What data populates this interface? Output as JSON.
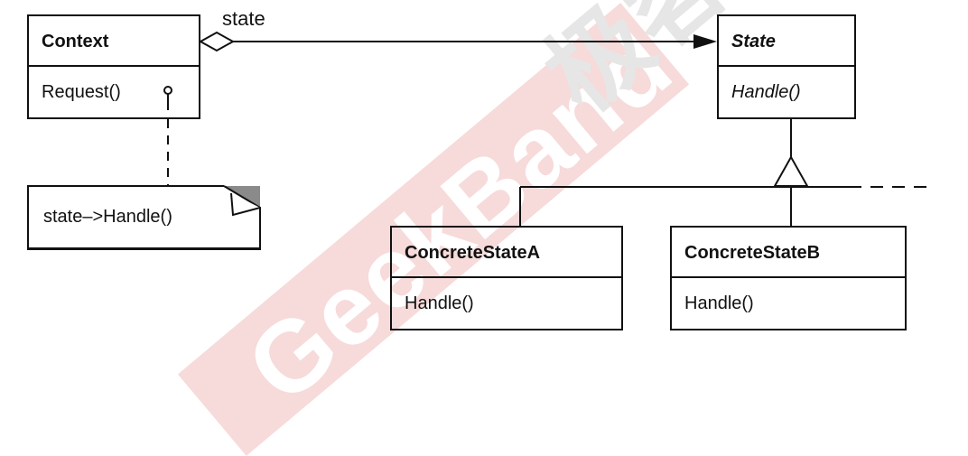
{
  "diagram": {
    "context": {
      "name": "Context",
      "operations": [
        "Request()"
      ]
    },
    "state": {
      "name": "State",
      "operations": [
        "Handle()"
      ],
      "abstract": true
    },
    "concrete_a": {
      "name": "ConcreteStateA",
      "operations": [
        "Handle()"
      ]
    },
    "concrete_b": {
      "name": "ConcreteStateB",
      "operations": [
        "Handle()"
      ]
    },
    "association": {
      "label": "state"
    },
    "note": {
      "text": "state–>Handle()"
    }
  },
  "watermark": {
    "latin": "GeekBand",
    "cjk": "极客",
    "band_color": "#f7dada"
  },
  "colors": {
    "line": "#111111",
    "note_fold": "#8a8a8a",
    "background": "#ffffff"
  }
}
